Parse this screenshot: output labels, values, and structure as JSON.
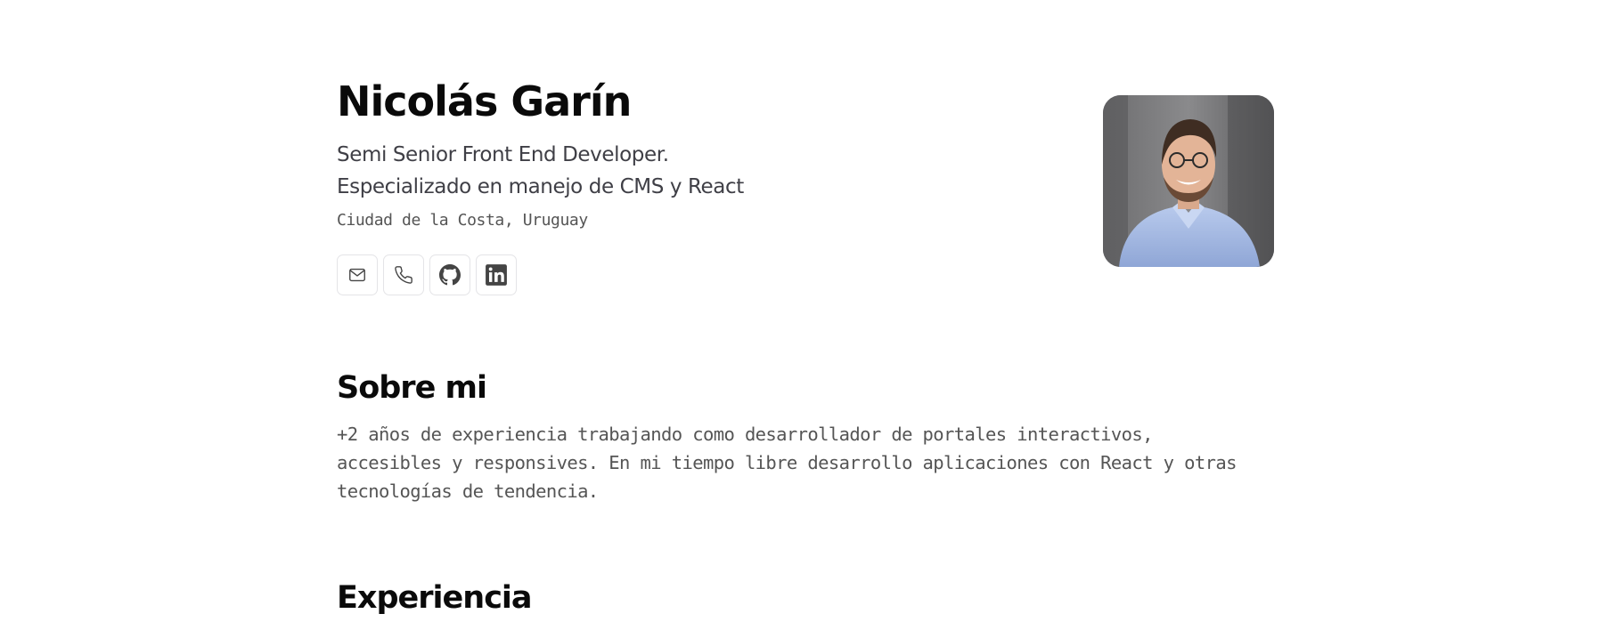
{
  "profile": {
    "name": "Nicolás Garín",
    "tagline_line1": "Semi Senior Front End Developer.",
    "tagline_line2": "Especializado en manejo de CMS y React",
    "location": "Ciudad de la Costa, Uruguay",
    "photo_alt": "Nicolás Garín"
  },
  "socials": [
    {
      "icon": "mail-icon"
    },
    {
      "icon": "phone-icon"
    },
    {
      "icon": "github-icon"
    },
    {
      "icon": "linkedin-icon"
    }
  ],
  "about": {
    "title": "Sobre mi",
    "text": "+2 años de experiencia trabajando como desarrollador de portales interactivos, accesibles y responsives. En mi tiempo libre desarrollo aplicaciones con React y otras tecnologías de tendencia."
  },
  "experience": {
    "title": "Experiencia"
  },
  "colors": {
    "heading": "#0a0a0a",
    "body_text": "#555555",
    "icon": "#444444",
    "border": "#e4e4e7"
  }
}
